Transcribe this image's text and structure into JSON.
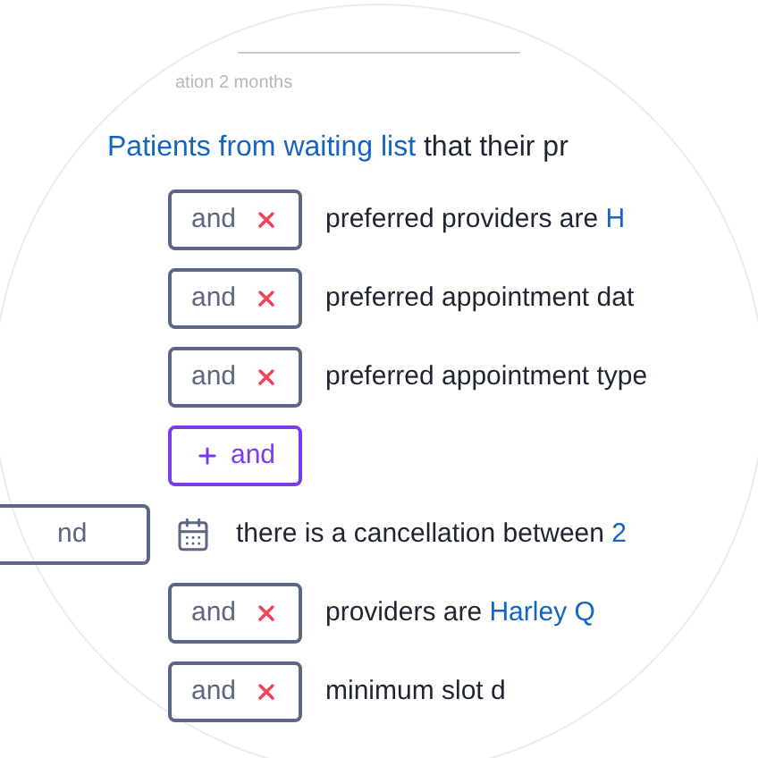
{
  "caption": "ation 2 months",
  "sentence": {
    "subject": "Patients from waiting list",
    "rest": "that their pr"
  },
  "conditions": [
    {
      "kind": "condition",
      "operator": "and",
      "text": "preferred providers are",
      "value": "H"
    },
    {
      "kind": "condition",
      "operator": "and",
      "text": "preferred appointment dat"
    },
    {
      "kind": "condition",
      "operator": "and",
      "text": "preferred appointment type"
    },
    {
      "kind": "add",
      "operator": "and"
    },
    {
      "kind": "group",
      "operator": "nd",
      "text": "there is a cancellation between",
      "value": "2"
    },
    {
      "kind": "condition",
      "operator": "and",
      "text": "providers are",
      "value": "Harley Q"
    },
    {
      "kind": "condition",
      "operator": "and",
      "text": "minimum slot d"
    }
  ]
}
